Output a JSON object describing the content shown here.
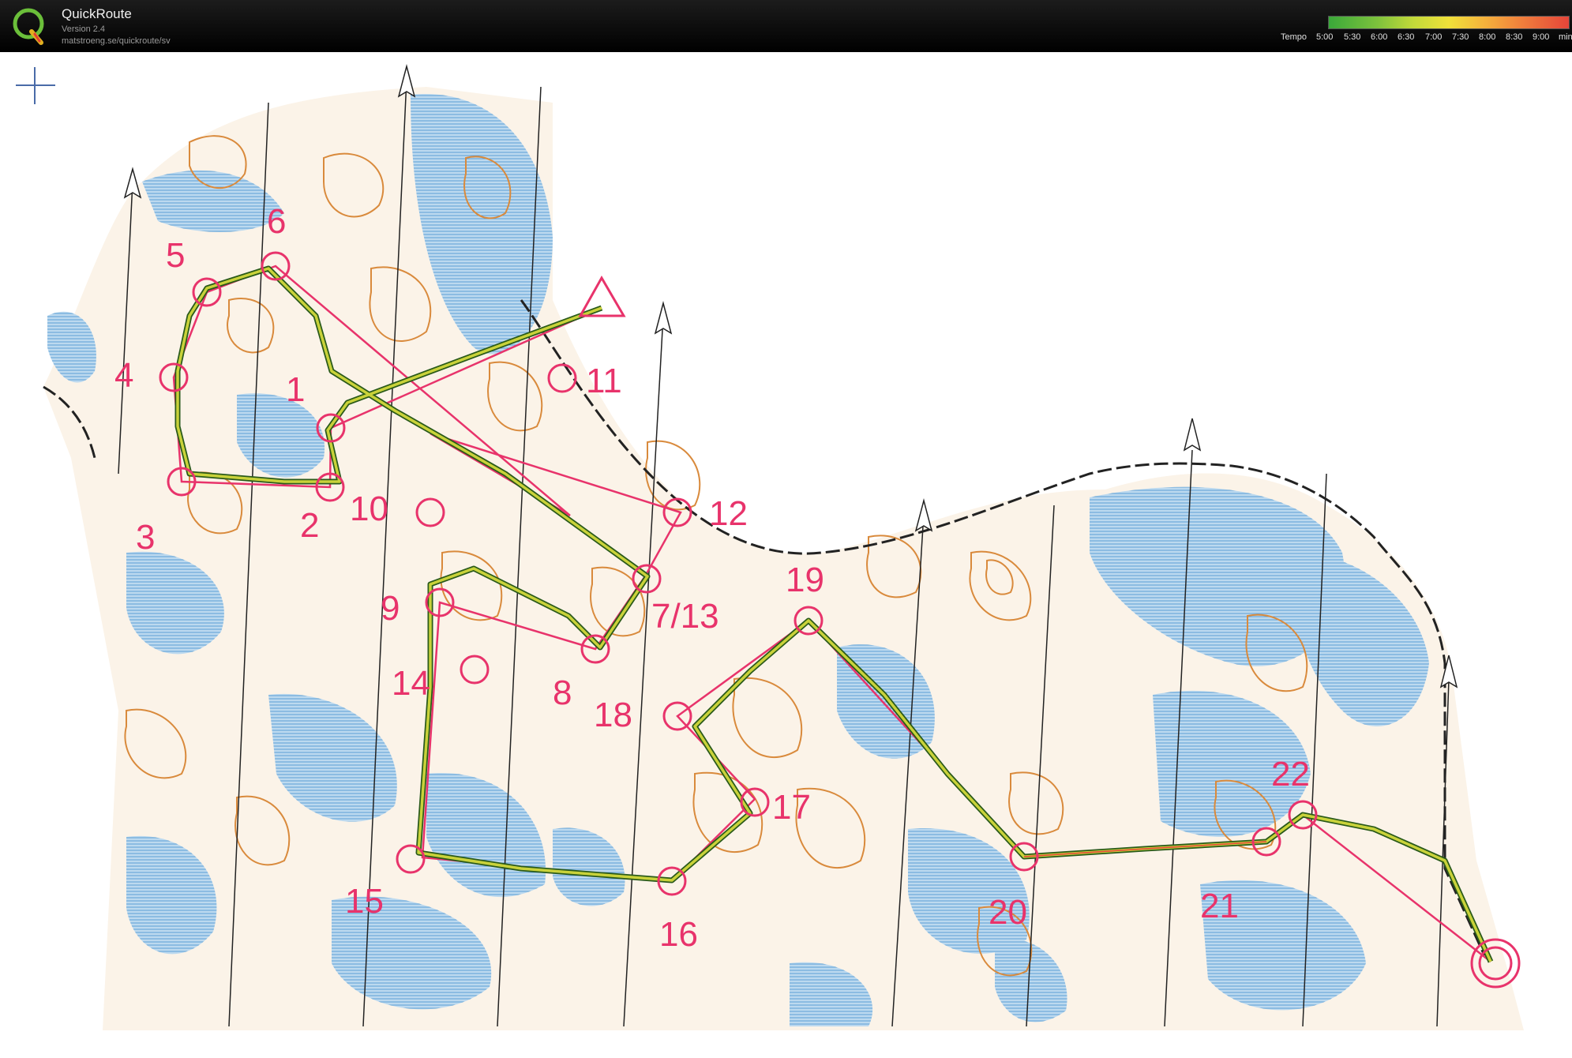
{
  "app": {
    "name": "QuickRoute",
    "version": "Version 2.4",
    "url": "matstroeng.se/quickroute/sv",
    "logo_letter": "Q"
  },
  "pace_legend": {
    "label": "Tempo",
    "ticks": [
      "5:00",
      "5:30",
      "6:00",
      "6:30",
      "7:00",
      "7:30",
      "8:00",
      "8:30",
      "9:00"
    ],
    "unit": "min/km",
    "colors": {
      "fast": "#3aa83a",
      "mid": "#f0e13a",
      "slow": "#e5453a"
    }
  },
  "map": {
    "colors": {
      "course": "#e8336b",
      "route_outline": "#2a5a1a",
      "route_fill": "#c9d23a",
      "contour": "#d98a3c",
      "water": "#7db3de",
      "north_line": "#222222",
      "border": "#222222"
    },
    "controls": [
      {
        "label": "1"
      },
      {
        "label": "2"
      },
      {
        "label": "3"
      },
      {
        "label": "4"
      },
      {
        "label": "5"
      },
      {
        "label": "6"
      },
      {
        "label": "7/13"
      },
      {
        "label": "8"
      },
      {
        "label": "9"
      },
      {
        "label": "10"
      },
      {
        "label": "11"
      },
      {
        "label": "12"
      },
      {
        "label": "14"
      },
      {
        "label": "15"
      },
      {
        "label": "16"
      },
      {
        "label": "17"
      },
      {
        "label": "18"
      },
      {
        "label": "19"
      },
      {
        "label": "20"
      },
      {
        "label": "21"
      },
      {
        "label": "22"
      }
    ]
  }
}
